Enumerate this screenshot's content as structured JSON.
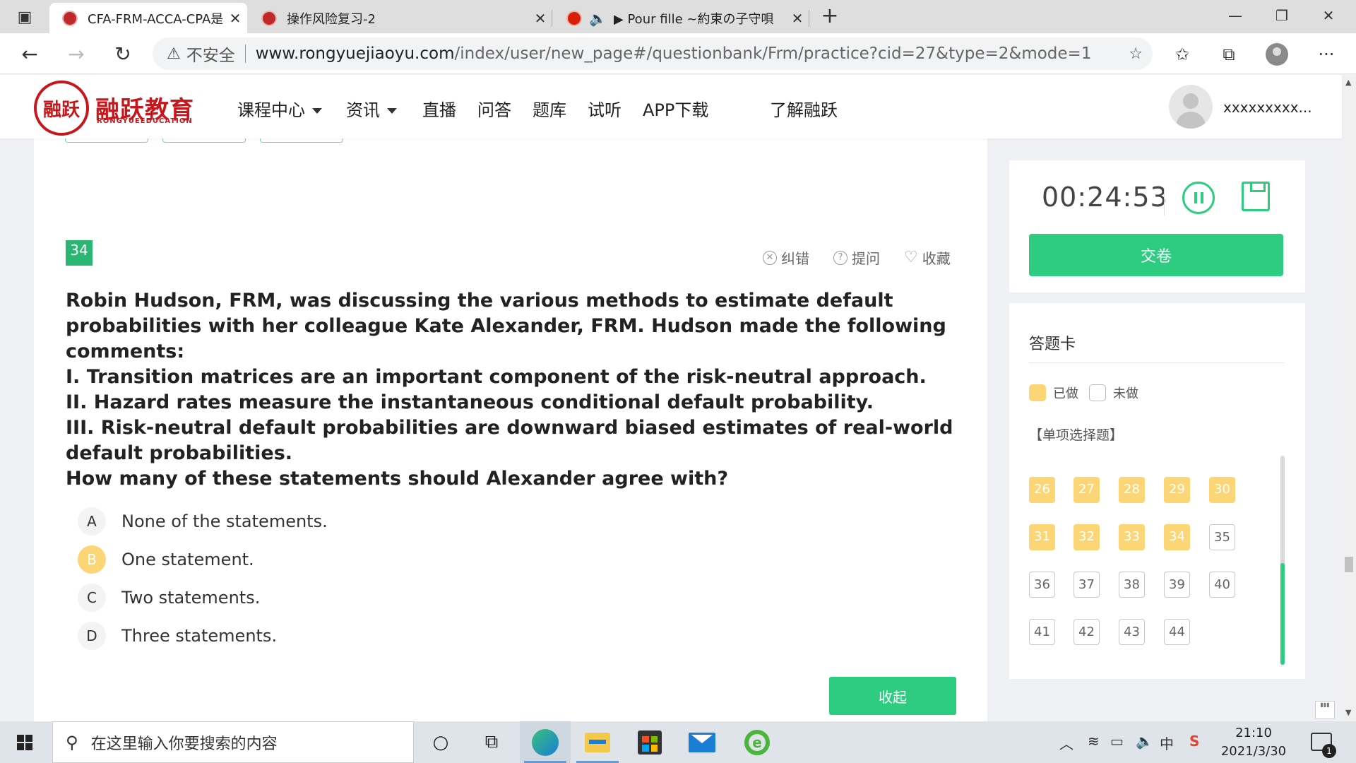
{
  "browser": {
    "tabs": [
      {
        "title": "CFA-FRM-ACCA-CPA是什么，注册",
        "active": true
      },
      {
        "title": "操作风险复习-2",
        "active": false
      },
      {
        "title": "▶ Pour fille ~約束の子守唄",
        "active": false
      }
    ],
    "close_glyph": "✕",
    "insecure_label": "不安全",
    "url_host": "www.rongyuejiaoyu.com",
    "url_path": "/index/user/new_page#/questionbank/Frm/practice?cid=27&type=2&mode=1"
  },
  "site": {
    "logo_text": "融跃教育",
    "logo_sub": "RONGYUEEDUCATION",
    "logo_mark": "融跃",
    "nav": [
      "课程中心",
      "资讯",
      "直播",
      "问答",
      "题库",
      "试听",
      "APP下载",
      "了解融跃"
    ],
    "user_name": "xxxxxxxxx..."
  },
  "question": {
    "number": "34",
    "actions": {
      "report": "纠错",
      "ask": "提问",
      "favorite": "收藏"
    },
    "lines": [
      "Robin Hudson, FRM, was discussing the various methods to estimate default",
      "probabilities with her colleague Kate Alexander, FRM. Hudson made the following",
      "comments:",
      "I. Transition matrices are an important component of the risk-neutral approach.",
      "II. Hazard rates measure the instantaneous conditional default probability.",
      "III. Risk-neutral default probabilities are downward biased estimates of real-world",
      "default probabilities.",
      "How many of these statements should Alexander agree with?"
    ],
    "options": [
      {
        "letter": "A",
        "text": "None of the statements.",
        "selected": false
      },
      {
        "letter": "B",
        "text": "One statement.",
        "selected": true
      },
      {
        "letter": "C",
        "text": "Two statements.",
        "selected": false
      },
      {
        "letter": "D",
        "text": "Three statements.",
        "selected": false
      }
    ],
    "collapse_label": "收起"
  },
  "timer": {
    "value": "00:24:53",
    "submit_label": "交卷"
  },
  "answer_card": {
    "title": "答题卡",
    "legend_done": "已做",
    "legend_todo": "未做",
    "section": "【单项选择题】",
    "cells": [
      {
        "n": "26",
        "done": true
      },
      {
        "n": "27",
        "done": true
      },
      {
        "n": "28",
        "done": true
      },
      {
        "n": "29",
        "done": true
      },
      {
        "n": "30",
        "done": true
      },
      {
        "n": "31",
        "done": true
      },
      {
        "n": "32",
        "done": true
      },
      {
        "n": "33",
        "done": true
      },
      {
        "n": "34",
        "done": true
      },
      {
        "n": "35",
        "done": false
      },
      {
        "n": "36",
        "done": false
      },
      {
        "n": "37",
        "done": false
      },
      {
        "n": "38",
        "done": false
      },
      {
        "n": "39",
        "done": false
      },
      {
        "n": "40",
        "done": false
      },
      {
        "n": "41",
        "done": false
      },
      {
        "n": "42",
        "done": false
      },
      {
        "n": "43",
        "done": false
      },
      {
        "n": "44",
        "done": false
      }
    ]
  },
  "colors": {
    "accent_green": "#2ecc80",
    "done_yellow": "#fcd576",
    "brand_red": "#c8161d"
  },
  "taskbar": {
    "search_placeholder": "在这里输入你要搜索的内容",
    "ime": "中",
    "time": "21:10",
    "date": "2021/3/30",
    "notification_count": "1"
  }
}
